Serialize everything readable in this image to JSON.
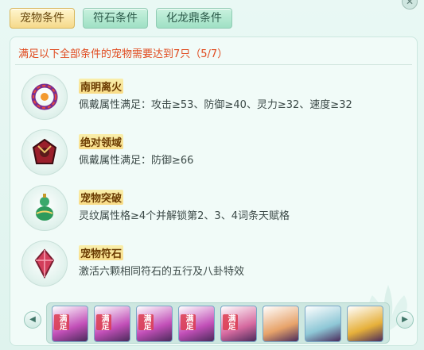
{
  "tabs": [
    {
      "label": "宠物条件",
      "active": true
    },
    {
      "label": "符石条件",
      "active": false
    },
    {
      "label": "化龙鼎条件",
      "active": false
    }
  ],
  "requirement": "满足以下全部条件的宠物需要达到7只（5/7）",
  "items": [
    {
      "title": "南明离火",
      "desc": "佩戴属性满足：攻击≥53、防御≥40、灵力≥32、速度≥32",
      "icon": "flame-ring-icon"
    },
    {
      "title": "绝对领域",
      "desc": "佩戴属性满足：防御≥66",
      "icon": "domain-emblem-icon"
    },
    {
      "title": "宠物突破",
      "desc": "灵纹属性格≥4个并解锁第2、3、4词条天赋格",
      "icon": "gourd-icon"
    },
    {
      "title": "宠物符石",
      "desc": "激活六颗相同符石的五行及八卦特效",
      "icon": "rune-crystal-icon"
    }
  ],
  "pets": [
    {
      "name": "pink-hair-pet",
      "badge": "满足",
      "color": "#c24fb8"
    },
    {
      "name": "pink-hair-pet",
      "badge": "满足",
      "color": "#c24fb8"
    },
    {
      "name": "pink-hair-pet",
      "badge": "满足",
      "color": "#c24fb8"
    },
    {
      "name": "pink-hair-pet",
      "badge": "满足",
      "color": "#c24fb8"
    },
    {
      "name": "pink-hair-pet",
      "badge": "满足",
      "color": "#d66aa0"
    },
    {
      "name": "cow-pet",
      "badge": "",
      "color": "#e7a36a"
    },
    {
      "name": "white-dragon-pet",
      "badge": "",
      "color": "#8ec7d6"
    },
    {
      "name": "golden-phoenix-pet",
      "badge": "",
      "color": "#e6b03a"
    }
  ]
}
